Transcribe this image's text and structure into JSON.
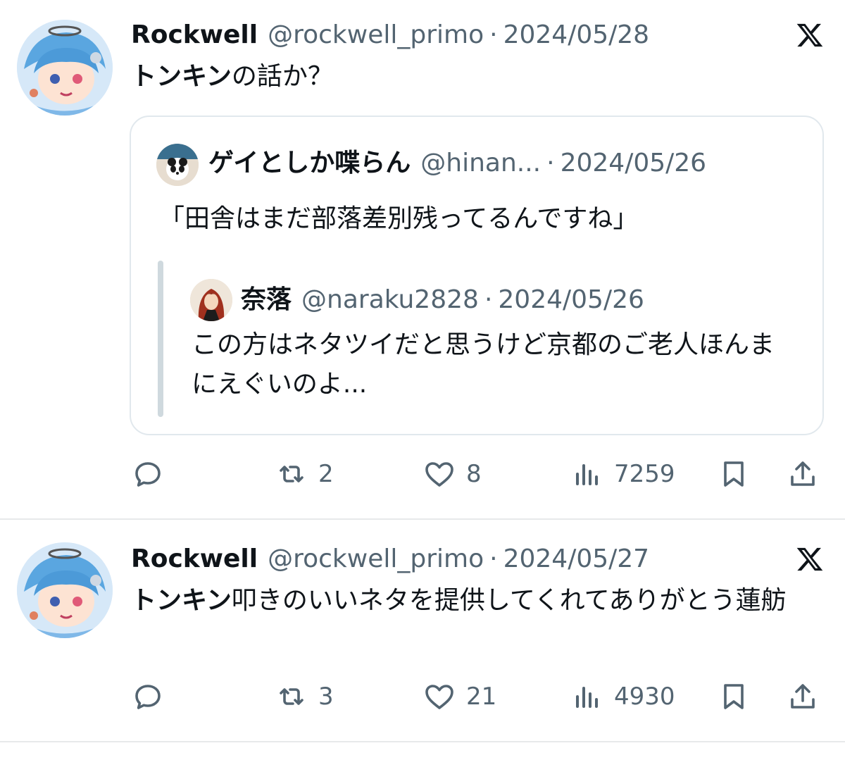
{
  "tweets": [
    {
      "display_name": "Rockwell",
      "handle": "@rockwell_primo",
      "separator": "·",
      "date": "2024/05/28",
      "text_bold": "トンキン",
      "text_rest": "の話か？",
      "quote": {
        "display_name": "ゲイとしか喋らん",
        "handle": "@hinan...",
        "separator": "·",
        "date": "2024/05/26",
        "text": "「田舎はまだ部落差別残ってるんですね」",
        "nested": {
          "display_name": "奈落",
          "handle": "@naraku2828",
          "separator": "·",
          "date": "2024/05/26",
          "text": "この方はネタツイだと思うけど京都のご老人ほんまにえぐいのよ..."
        }
      },
      "actions": {
        "retweets": "2",
        "likes": "8",
        "views": "7259"
      }
    },
    {
      "display_name": "Rockwell",
      "handle": "@rockwell_primo",
      "separator": "·",
      "date": "2024/05/27",
      "text_bold": "トンキン",
      "text_rest": "叩きのいいネタを提供してくれてありがとう蓮舫",
      "actions": {
        "retweets": "3",
        "likes": "21",
        "views": "4930"
      }
    }
  ],
  "icons": {
    "brand": "x-logo-icon",
    "reply": "reply-icon",
    "retweet": "retweet-icon",
    "like": "heart-icon",
    "views": "views-chart-icon",
    "bookmark": "bookmark-icon",
    "share": "share-icon"
  },
  "colors": {
    "text": "#0f1419",
    "secondary": "#536471",
    "border": "#e1e8ed"
  }
}
